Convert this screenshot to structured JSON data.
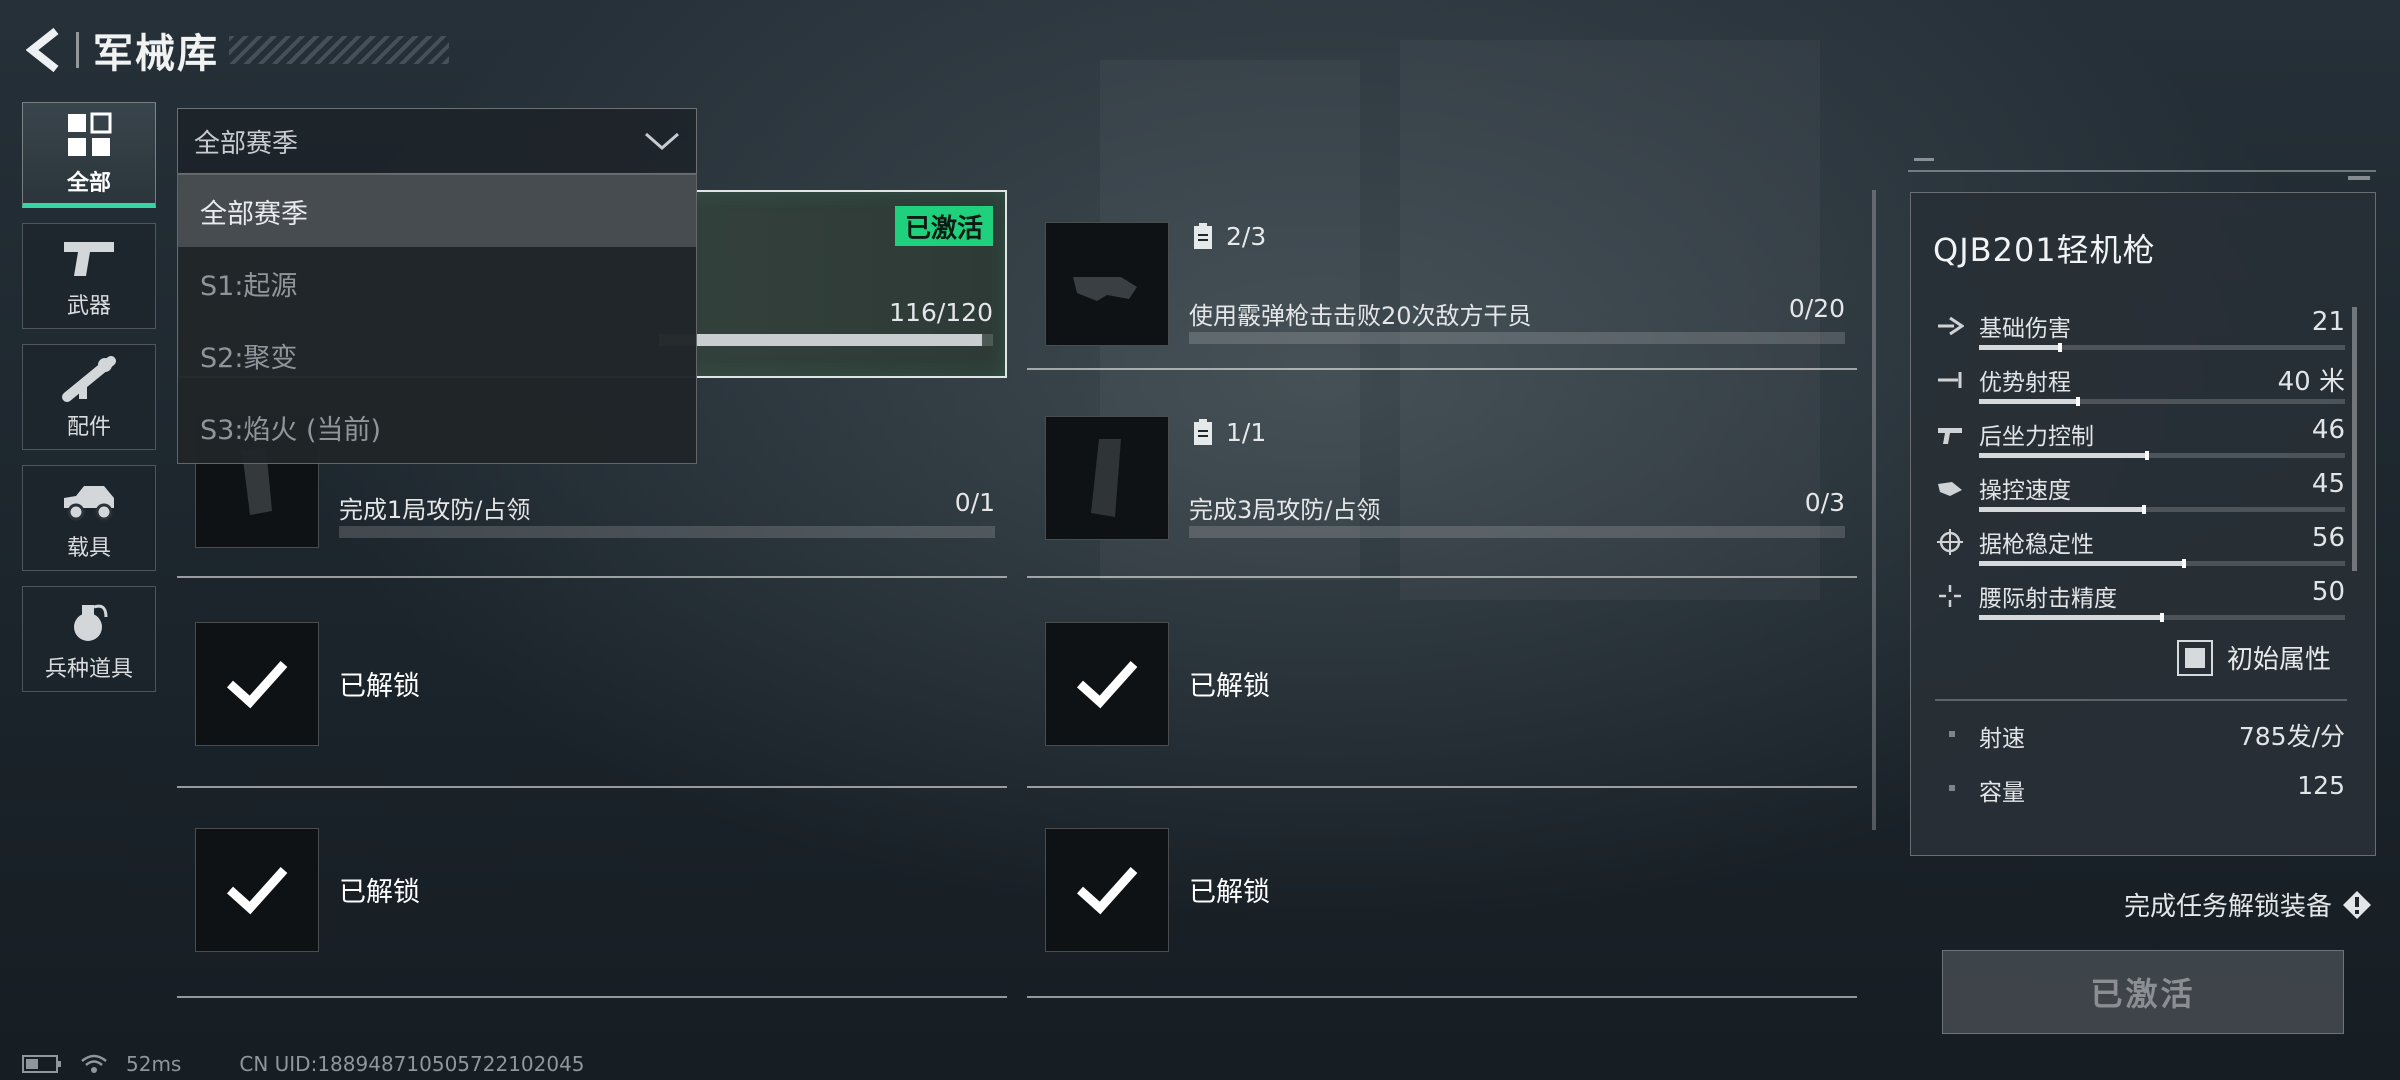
{
  "header": {
    "title": "军械库"
  },
  "nav": {
    "items": [
      {
        "label": "全部",
        "icon": "grid-icon",
        "active": true
      },
      {
        "label": "武器",
        "icon": "pistol-icon"
      },
      {
        "label": "配件",
        "icon": "scope-icon"
      },
      {
        "label": "载具",
        "icon": "vehicle-icon"
      },
      {
        "label": "兵种道具",
        "icon": "grenade-icon"
      }
    ]
  },
  "season_filter": {
    "value": "全部赛季",
    "options": [
      "全部赛季",
      "S1:起源",
      "S2:聚变",
      "S3:焰火 (当前)"
    ]
  },
  "quests": {
    "active": {
      "badge": "已激活",
      "progress": "116/120",
      "fraction": 0.967
    },
    "shotgun": {
      "count": "2/3",
      "desc": "使用霰弹枪击击败20次敌方干员",
      "progress": "0/20",
      "fraction": 0
    },
    "attack1": {
      "desc": "完成1局攻防/占领",
      "progress": "0/1",
      "fraction": 0
    },
    "attack3": {
      "count": "1/1",
      "desc": "完成3局攻防/占领",
      "progress": "0/3",
      "fraction": 0
    },
    "unlocked_label": "已解锁"
  },
  "weapon": {
    "name": "QJB201轻机枪",
    "stats": [
      {
        "label": "基础伤害",
        "value": "21",
        "icon": "damage-icon",
        "fill": 0.22
      },
      {
        "label": "优势射程",
        "value": "40 米",
        "icon": "range-icon",
        "fill": 0.27
      },
      {
        "label": "后坐力控制",
        "value": "46",
        "icon": "recoil-icon",
        "fill": 0.46
      },
      {
        "label": "操控速度",
        "value": "45",
        "icon": "handling-icon",
        "fill": 0.45
      },
      {
        "label": "据枪稳定性",
        "value": "56",
        "icon": "crosshair-icon",
        "fill": 0.56
      },
      {
        "label": "腰际射击精度",
        "value": "50",
        "icon": "hipfire-icon",
        "fill": 0.5
      }
    ],
    "initial_attr_label": "初始属性",
    "extras": [
      {
        "label": "射速",
        "value": "785发/分"
      },
      {
        "label": "容量",
        "value": "125"
      }
    ]
  },
  "unlock_hint": "完成任务解锁装备",
  "activate_button": "已激活",
  "footer": {
    "ping": "52ms",
    "uid": "CN UID:188948710505722102045"
  },
  "colors": {
    "accent": "#35d6a3",
    "badge": "#1fd17c"
  }
}
